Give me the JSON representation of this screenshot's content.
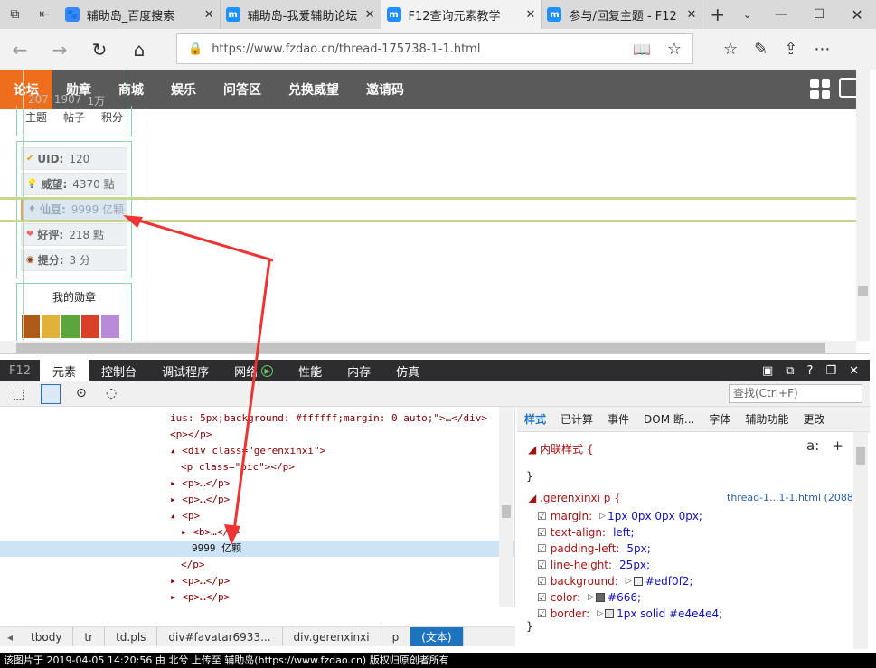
{
  "browser": {
    "tabs": [
      {
        "title": "辅助岛_百度搜索",
        "logo_color": "#3388ff",
        "logo_text": "🐾"
      },
      {
        "title": "辅助岛-我爱辅助论坛",
        "logo_color": "#1e90ff",
        "logo_text": "m"
      },
      {
        "title": "F12查询元素教学",
        "logo_color": "#1e90ff",
        "logo_text": "m"
      },
      {
        "title": "参与/回复主题 - F12",
        "logo_color": "#1e90ff",
        "logo_text": "m"
      }
    ],
    "url": "https://www.fzdao.cn/thread-175738-1-1.html"
  },
  "site_nav": [
    "论坛",
    "勋章",
    "商城",
    "娱乐",
    "问答区",
    "兑换威望",
    "邀请码"
  ],
  "profile": {
    "counts": [
      "207",
      "1907",
      "1万"
    ],
    "count_labels": [
      "主题",
      "帖子",
      "积分"
    ],
    "stats": [
      {
        "icon": "uid-icon",
        "label": "UID:",
        "value": "120"
      },
      {
        "icon": "bulb-icon",
        "label": "威望:",
        "value": "4370 點"
      },
      {
        "icon": "gem-icon",
        "label": "仙豆:",
        "value": "9999 亿颗"
      },
      {
        "icon": "heart-icon",
        "label": "好评:",
        "value": "218 點"
      },
      {
        "icon": "medal-icon",
        "label": "提分:",
        "value": "3 分"
      }
    ],
    "medals_title": "我的勋章"
  },
  "devtools": {
    "tabs": [
      "F12",
      "元素",
      "控制台",
      "调试程序",
      "网络",
      "性能",
      "内存",
      "仿真"
    ],
    "search_placeholder": "查找(Ctrl+F)",
    "dom_lines": [
      {
        "indent": 0,
        "text": "ius: 5px;background: #ffffff;margin: 0 auto;\">…</div>"
      },
      {
        "indent": 0,
        "text": "<p></p>"
      },
      {
        "indent": 0,
        "text": "▴ <div class=\"gerenxinxi\">"
      },
      {
        "indent": 1,
        "text": "<p class=\"pic\"></p>"
      },
      {
        "indent": 0,
        "text": "▸ <p>…</p>"
      },
      {
        "indent": 0,
        "text": "▸ <p>…</p>"
      },
      {
        "indent": 0,
        "text": "▴ <p>"
      },
      {
        "indent": 1,
        "text": "▸ <b>…</b>"
      },
      {
        "indent": 2,
        "text": "9999 亿颗"
      },
      {
        "indent": 1,
        "text": "</p>"
      },
      {
        "indent": 0,
        "text": "▸ <p>…</p>"
      },
      {
        "indent": 0,
        "text": "▸ <p>…</p>"
      }
    ],
    "breadcrumb": [
      "tbody",
      "tr",
      "td.pls",
      "div#favatar6933...",
      "div.gerenxinxi",
      "p",
      "(文本)"
    ],
    "style_tabs": [
      "样式",
      "已计算",
      "事件",
      "DOM 断...",
      "字体",
      "辅助功能",
      "更改"
    ],
    "inline_style": "◢ 内联样式  {",
    "rule_selector": "◢ .gerenxinxi p  {",
    "rule_source": "thread-1...1-1.html (2088)",
    "props": [
      {
        "name": "margin:",
        "value": "1px 0px 0px 0px;",
        "swatch": ""
      },
      {
        "name": "text-align:",
        "value": "left;",
        "swatch": ""
      },
      {
        "name": "padding-left:",
        "value": "5px;",
        "swatch": ""
      },
      {
        "name": "line-height:",
        "value": "25px;",
        "swatch": ""
      },
      {
        "name": "background:",
        "value": "#edf0f2;",
        "swatch": "#edf0f2"
      },
      {
        "name": "color:",
        "value": "#666;",
        "swatch": "#666666"
      },
      {
        "name": "border:",
        "value": "1px solid #e4e4e4;",
        "swatch": "#e4e4e4"
      }
    ]
  },
  "status_text": "该图片于 2019-04-05 14:20:56 由 北兮 上传至 辅助岛(https://www.fzdao.cn) 版权归原创者所有"
}
